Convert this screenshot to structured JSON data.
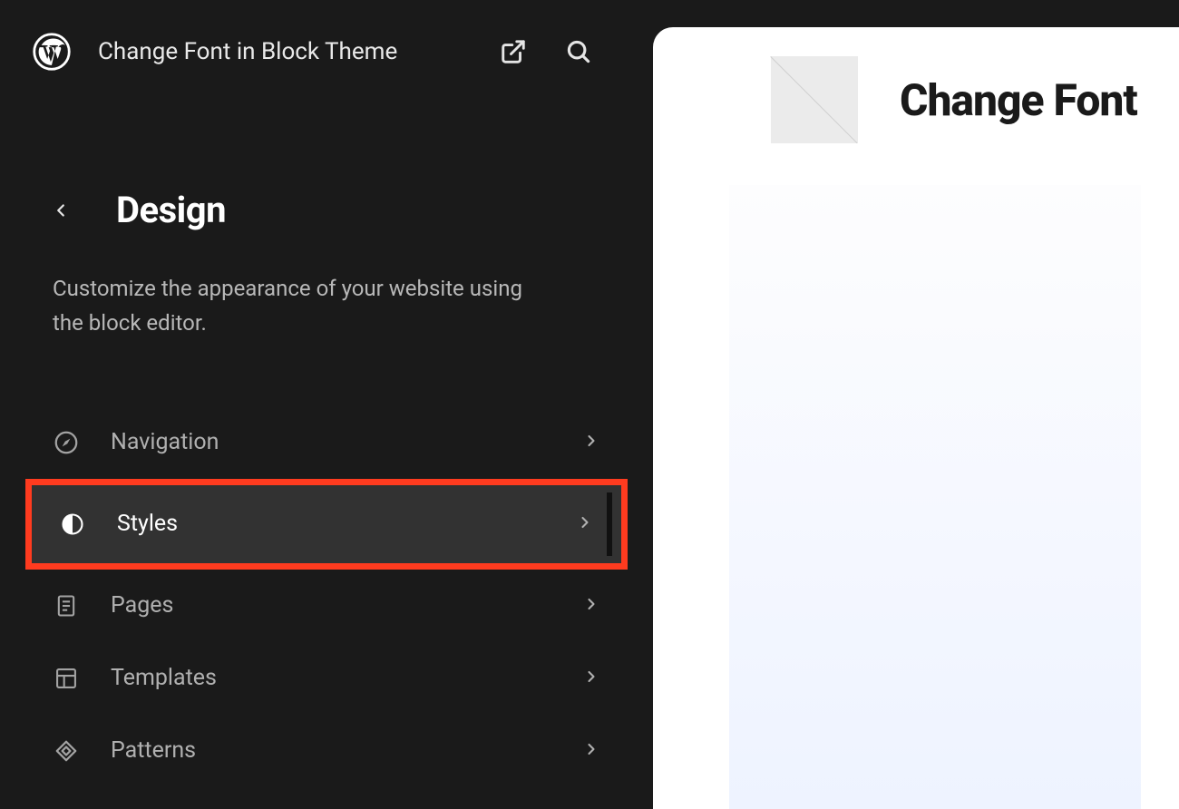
{
  "header": {
    "site_title": "Change Font in Block Theme"
  },
  "section": {
    "title": "Design",
    "description": "Customize the appearance of your website using the block editor."
  },
  "nav": {
    "items": [
      {
        "label": "Navigation",
        "icon": "compass-icon",
        "active": false,
        "highlighted": false
      },
      {
        "label": "Styles",
        "icon": "half-circle-icon",
        "active": true,
        "highlighted": true
      },
      {
        "label": "Pages",
        "icon": "page-icon",
        "active": false,
        "highlighted": false
      },
      {
        "label": "Templates",
        "icon": "layout-icon",
        "active": false,
        "highlighted": false
      },
      {
        "label": "Patterns",
        "icon": "diamond-icon",
        "active": false,
        "highlighted": false
      }
    ]
  },
  "preview": {
    "site_title": "Change Font"
  },
  "icons": {
    "external": "external-link-icon",
    "search": "search-icon",
    "back": "chevron-left-icon",
    "chevron": "chevron-right-icon"
  },
  "colors": {
    "highlight": "#ff3b1f",
    "sidebar_bg": "#1a1a1a",
    "active_bg": "#323232"
  }
}
